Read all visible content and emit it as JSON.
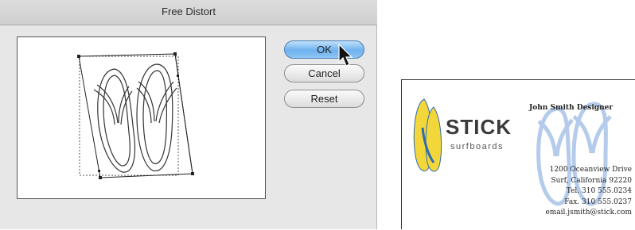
{
  "dialog": {
    "title": "Free Distort",
    "buttons": {
      "ok": "OK",
      "cancel": "Cancel",
      "reset": "Reset"
    }
  },
  "card": {
    "logo_word": "STICK",
    "logo_sub": "surfboards",
    "name_line": "John Smith Designer",
    "address_lines": [
      "1200 Oceanview Drive",
      "Surf, California 92220",
      "Tel. 310 555.0234",
      "Fax. 310 555.0237",
      "email.jsmith@stick.com"
    ]
  },
  "colors": {
    "ok_button": "#6fb2ef",
    "logo_yellow": "#f2d63a",
    "logo_blue": "#2f6db0",
    "watermark_blue": "#a9c3e8"
  }
}
